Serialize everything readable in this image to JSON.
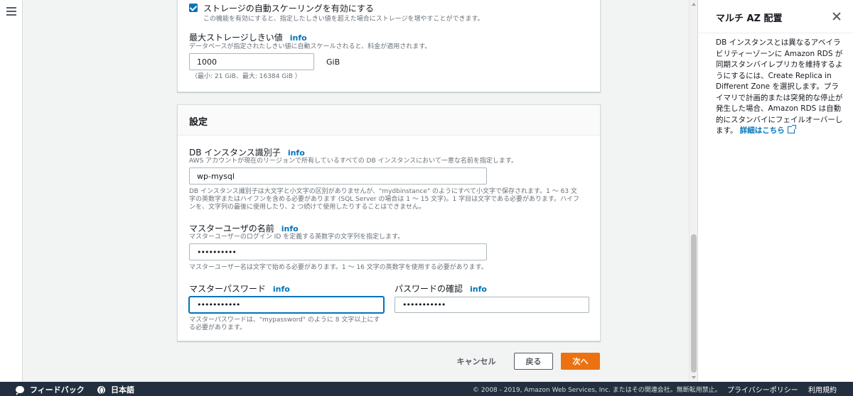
{
  "storage": {
    "autoscale_label": "ストレージの自動スケーリングを有効にする",
    "autoscale_hint": "この機能を有効にすると、指定したしきい値を超えた場合にストレージを増やすことができます。",
    "max_label": "最大ストレージしきい値",
    "info": "info",
    "max_hint": "データベースが指定されたしきい値に自動スケールされると、料金が適用されます。",
    "max_value": "1000",
    "max_unit": "GiB",
    "max_range": "（最小: 21 GiB、最大: 16384 GiB ）"
  },
  "settings": {
    "title": "設定",
    "db_id_label": "DB インスタンス識別子",
    "db_id_hint": "AWS アカウントが現在のリージョンで所有しているすべての DB インスタンスにおいて一意な名前を指定します。",
    "db_id_value": "wp-mysql",
    "db_id_rules_1": "DB インスタンス識別子は大文字と小文字の区別がありませんが、\"mydbinstance\" のようにすべて小文字で保存されます。1 ～ 63 文",
    "db_id_rules_2": "字の英数字またはハイフンを含める必要があります (SQL Server の場合は 1 ～ 15 文字)。1 字目は文字である必要があります。ハイフ",
    "db_id_rules_3": "ンを、文字列の最後に使用したり、2 つ続けて使用したりすることはできません。",
    "master_user_label": "マスターユーザの名前",
    "master_user_hint": "マスターユーザーのログイン ID を定義する英数字の文字列を指定します。",
    "master_user_value": "••••••••••",
    "master_user_rules": "マスターユーザー名は文字で始める必要があります。1 ～ 16 文字の英数字を使用する必要があります。",
    "master_pw_label": "マスターパスワード",
    "master_pw_value": "•••••••••••",
    "master_pw_rules_1": "マスターパスワードは、\"mypassword\" のように 8 文字以上にす",
    "master_pw_rules_2": "る必要があります。",
    "confirm_pw_label": "パスワードの確認",
    "confirm_pw_value": "•••••••••••"
  },
  "actions": {
    "cancel": "キャンセル",
    "back": "戻る",
    "next": "次へ"
  },
  "help_panel": {
    "title": "マルチ AZ 配置",
    "body": "DB インスタンスとは異なるアベイラビリティーゾーンに Amazon RDS が同期スタンバイレプリカを維持するようにするには、Create Replica in Different Zone を選択します。プライマリで計画的または突発的な停止が発生した場合、Amazon RDS は自動的にスタンバイにフェイルオーバーします。",
    "link": "詳細はこちら"
  },
  "footer": {
    "feedback": "フィードバック",
    "language": "日本語",
    "copyright": "© 2008 - 2019, Amazon Web Services, Inc. またはその関連会社。無断転用禁止。",
    "privacy": "プライバシーポリシー",
    "terms": "利用規約"
  },
  "colors": {
    "accent": "#0073bb",
    "primary_button": "#ec7211",
    "footer_bg": "#232f3e"
  }
}
